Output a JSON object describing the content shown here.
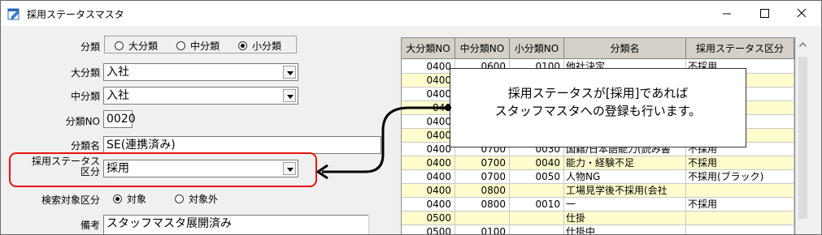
{
  "window": {
    "title": "採用ステータスマスタ",
    "icon": "edit-form-icon"
  },
  "form": {
    "classification_label": "分類",
    "classification_options": [
      "大分類",
      "中分類",
      "小分類"
    ],
    "classification_selected": "小分類",
    "major_label": "大分類",
    "major_value": "入社",
    "middle_label": "中分類",
    "middle_value": "入社",
    "class_no_label": "分類NO",
    "class_no_value": "0020",
    "class_name_label": "分類名",
    "class_name_value": "SE(連携済み)",
    "status_label_line1": "採用ステータス",
    "status_label_line2": "区分",
    "status_value": "採用",
    "search_label": "検索対象区分",
    "search_options": [
      "対象",
      "対象外"
    ],
    "search_selected": "対象",
    "memo_label": "備考",
    "memo_value": "スタッフマスタ展開済み"
  },
  "grid": {
    "columns": [
      "大分類NO",
      "中分類NO",
      "小分類NO",
      "分類名",
      "採用ステータス区分"
    ],
    "rows": [
      {
        "c1": "0400",
        "c2": "0600",
        "c3": "0100",
        "name": "他社決定",
        "status": "不採用",
        "bg": "w"
      },
      {
        "c1": "0400",
        "c2": "",
        "c3": "",
        "name": "",
        "status": "",
        "bg": "y"
      },
      {
        "c1": "0400",
        "c2": "",
        "c3": "",
        "name": "",
        "status": "",
        "bg": "w"
      },
      {
        "c1": "040",
        "c2": "",
        "c3": "",
        "name": "",
        "status": "",
        "bg": "y"
      },
      {
        "c1": "0400",
        "c2": "",
        "c3": "",
        "name": "",
        "status": "",
        "bg": "w"
      },
      {
        "c1": "0400",
        "c2": "",
        "c3": "",
        "name": "",
        "status": "",
        "bg": "y"
      },
      {
        "c1": "0400",
        "c2": "0700",
        "c3": "0030",
        "name": "国籍/日本語能力(読み書",
        "status": "不採用",
        "bg": "w"
      },
      {
        "c1": "0400",
        "c2": "0700",
        "c3": "0040",
        "name": "能力・経験不足",
        "status": "不採用",
        "bg": "y"
      },
      {
        "c1": "0400",
        "c2": "0700",
        "c3": "0050",
        "name": "人物NG",
        "status": "不採用(ブラック)",
        "bg": "w"
      },
      {
        "c1": "0400",
        "c2": "0800",
        "c3": "",
        "name": "工場見学後不採用(会社",
        "status": "",
        "bg": "y"
      },
      {
        "c1": "0400",
        "c2": "0800",
        "c3": "0010",
        "name": "一",
        "status": "不採用",
        "bg": "w"
      },
      {
        "c1": "0500",
        "c2": "",
        "c3": "",
        "name": "仕掛",
        "status": "",
        "bg": "y"
      },
      {
        "c1": "0500",
        "c2": "0100",
        "c3": "",
        "name": "仕掛中",
        "status": "",
        "bg": "w"
      }
    ]
  },
  "callout": {
    "line1": "採用ステータスが[採用]であれば",
    "line2": "スタッフマスタへの登録も行います。"
  },
  "colors": {
    "highlight_box": "#e8140e",
    "row_yellow": "#fffccd",
    "grid_header": "#d4d0c8"
  }
}
